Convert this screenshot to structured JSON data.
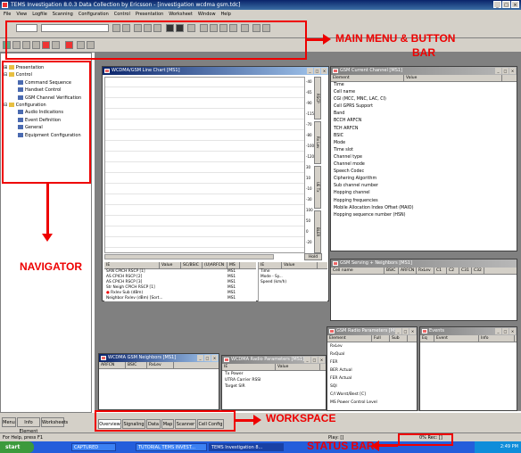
{
  "app": {
    "title": "TEMS Investigation 8.0.3 Data Collection by Ericsson - [investigation wcdma gsm.tdc]"
  },
  "window_buttons": [
    "_",
    "□",
    "×"
  ],
  "menu": [
    "File",
    "View",
    "Logfile",
    "Scanning",
    "Configuration",
    "Control",
    "Presentation",
    "Worksheet",
    "Window",
    "Help"
  ],
  "annotations": {
    "main_menu_line1": "MAIN MENU & BUTTON",
    "main_menu_line2": "BAR",
    "navigator": "NAVIGATOR",
    "workspace": "WORKSPACE",
    "status_bar": "STATUS BAR"
  },
  "navigator": {
    "items": [
      {
        "label": "Presentation",
        "level": 0,
        "prefix": "⊞"
      },
      {
        "label": "Control",
        "level": 0,
        "prefix": "⊟"
      },
      {
        "label": "Command Sequence",
        "level": 1,
        "prefix": ""
      },
      {
        "label": "Handset Control",
        "level": 1,
        "prefix": ""
      },
      {
        "label": "GSM Channel Verification",
        "level": 1,
        "prefix": ""
      },
      {
        "label": "Configuration",
        "level": 0,
        "prefix": "⊟"
      },
      {
        "label": "Audio Indications",
        "level": 1,
        "prefix": ""
      },
      {
        "label": "Event Definition",
        "level": 1,
        "prefix": ""
      },
      {
        "label": "General",
        "level": 1,
        "prefix": ""
      },
      {
        "label": "Equipment Configuration",
        "level": 1,
        "prefix": ""
      }
    ],
    "tabs": [
      "Menu",
      "Info Element",
      "Worksheets"
    ]
  },
  "windows": {
    "line_chart": {
      "title": "WCDMA/GSM Line Chart [MS1]",
      "gauges": [
        "RSCP",
        "Rx Lev",
        "UE Tx",
        "BLER"
      ],
      "gauge_ticks": [
        [
          "-40",
          "-65",
          "-90",
          "-115"
        ],
        [
          "-70",
          "-80",
          "-100",
          "-120"
        ],
        [
          "30",
          "10",
          "-10",
          "-30"
        ],
        [
          "100",
          "50",
          "0",
          "-20"
        ]
      ],
      "hold_label": "Hold",
      "table_headers": [
        "IE",
        "Value",
        "SC/BSIC",
        "(U)ARFCN",
        "MS"
      ],
      "table_rows": [
        [
          "SAN CPICH RSCP [1]",
          "MS1"
        ],
        [
          "AS CPICH RSCP [2]",
          "MS1"
        ],
        [
          "AS CPICH RSCP [3]",
          "MS1"
        ],
        [
          "Str Neigh CPICH RSCP [1]",
          "MS1"
        ],
        [
          "Rxlev Sub (dBm)",
          "MS1"
        ],
        [
          "Neighbor Rxlev (dBm) [Sort...",
          "MS1"
        ]
      ],
      "right_headers": [
        "IE",
        "Value"
      ],
      "right_rows": [
        "Time",
        "Mode - Sy...",
        "Speed (km/h)"
      ]
    },
    "gsm_current": {
      "title": "GSM Current Channel [MS1]",
      "headers": [
        "Element",
        "Value"
      ],
      "rows": [
        "Time",
        "Cell name",
        "CGI (MCC, MNC, LAC, CI)",
        "Cell GPRS Support",
        "Band",
        "BCCH ARFCN",
        "TCH ARFCN",
        "BSIC",
        "Mode",
        "Time slot",
        "Channel type",
        "Channel mode",
        "Speech Codec",
        "Ciphering Algorithm",
        "Sub channel number",
        "Hopping channel",
        "Hopping frequencies",
        "Mobile Allocation Index Offset (MAIO)",
        "Hopping sequence number (HSN)"
      ]
    },
    "gsm_serving": {
      "title": "GSM Serving + Neighbors [MS1]",
      "headers": [
        "Cell name",
        "BSIC",
        "ARFCN",
        "RxLev",
        "C1",
        "C2",
        "C31",
        "C32"
      ]
    },
    "gsm_radio": {
      "title": "GSM Radio Parameters [MS1]",
      "headers": [
        "Element",
        "Full",
        "Sub"
      ],
      "rows": [
        "RxLev",
        "RxQual",
        "FER",
        "BER Actual",
        "FER Actual",
        "SQI",
        "C/I Worst/Best [C]",
        "MS Power Control Level"
      ]
    },
    "events": {
      "title": "Events",
      "headers": [
        "Eq",
        "Event",
        "Info"
      ]
    },
    "wcdma_neighbors": {
      "title": "WCDMA GSM Neighbors [MS1]",
      "headers": [
        "ARFCN",
        "BSIC",
        "RxLev"
      ]
    },
    "wcdma_radio": {
      "title": "WCDMA Radio Parameters [MS1]",
      "headers": [
        "IE",
        "Value"
      ],
      "rows": [
        "Tx Power",
        "UTRA Carrier RSSI",
        "Target SIR"
      ]
    }
  },
  "workspace_tabs": [
    "Overview",
    "Signaling",
    "Data",
    "Map",
    "Scanner",
    "Cell Config"
  ],
  "status": {
    "left": "For Help, press F1",
    "mid": "Play: []",
    "right": "0% Rec: []"
  },
  "taskbar": {
    "start": "start",
    "items": [
      "CAPTURED",
      "TUTORIAL TEMS INVEST...",
      "TEMS Investigation 8..."
    ],
    "clock": "2:49 PM"
  }
}
